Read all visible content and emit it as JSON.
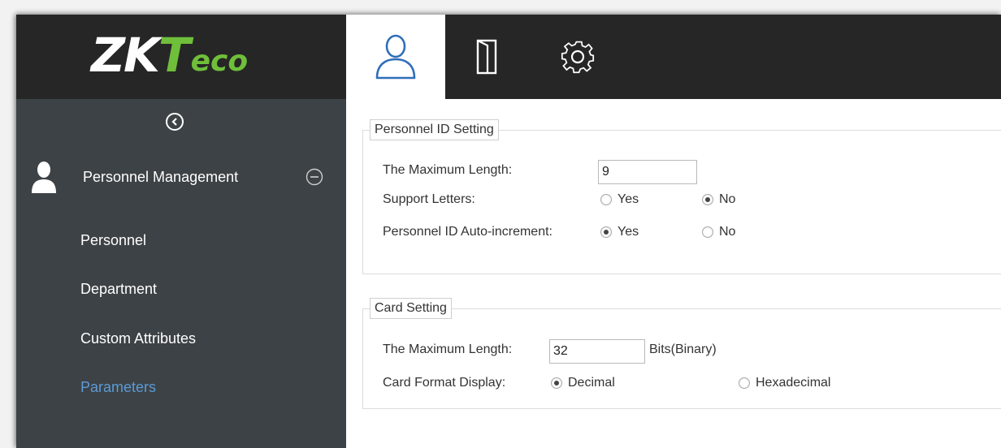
{
  "sidebar": {
    "logo": {
      "part1": "ZK",
      "part2": "T",
      "part3": "eco"
    },
    "module": {
      "label": "Personnel Management"
    },
    "menu": [
      {
        "label": "Personnel"
      },
      {
        "label": "Department"
      },
      {
        "label": "Custom Attributes"
      },
      {
        "label": "Parameters",
        "active": true
      }
    ]
  },
  "tabs": [
    {
      "icon": "person-icon",
      "active": true
    },
    {
      "icon": "door-icon",
      "active": false
    },
    {
      "icon": "gear-icon",
      "active": false
    }
  ],
  "personnel_id_setting": {
    "title": "Personnel ID Setting",
    "max_length_label": "The Maximum Length:",
    "max_length_value": "9",
    "support_letters_label": "Support Letters:",
    "support_letters_yes": "Yes",
    "support_letters_no": "No",
    "support_letters_selected": "No",
    "auto_increment_label": "Personnel ID Auto-increment:",
    "auto_increment_yes": "Yes",
    "auto_increment_no": "No",
    "auto_increment_selected": "Yes"
  },
  "card_setting": {
    "title": "Card Setting",
    "max_length_label": "The Maximum Length:",
    "max_length_value": "32",
    "unit": "Bits(Binary)",
    "format_label": "Card Format Display:",
    "decimal": "Decimal",
    "hexadecimal": "Hexadecimal",
    "format_selected": "Decimal"
  },
  "colors": {
    "sidebar_bg": "#3d4246",
    "header_bg": "#262626",
    "accent_green": "#6fbf3a",
    "active_link": "#5b9bd5"
  }
}
